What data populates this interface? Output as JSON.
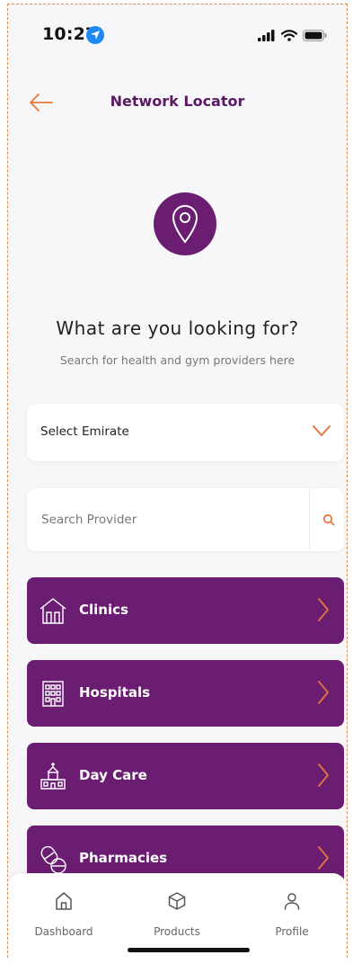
{
  "status_bar": {
    "time": "10:27"
  },
  "header": {
    "title": "Network Locator"
  },
  "hero": {
    "title": "What are you looking for?",
    "subtitle": "Search for health and gym providers here"
  },
  "select": {
    "label": "Select Emirate"
  },
  "search": {
    "placeholder": "Search Provider"
  },
  "categories": [
    {
      "label": "Clinics",
      "icon": "clinic-icon"
    },
    {
      "label": "Hospitals",
      "icon": "hospital-icon"
    },
    {
      "label": "Day Care",
      "icon": "day-care-icon"
    },
    {
      "label": "Pharmacies",
      "icon": "pharmacy-icon"
    }
  ],
  "bottom_nav": [
    {
      "label": "Dashboard",
      "icon": "home-icon"
    },
    {
      "label": "Products",
      "icon": "box-icon"
    },
    {
      "label": "Profile",
      "icon": "user-icon"
    }
  ],
  "colors": {
    "primary": "#6b1d72",
    "accent": "#e8763a",
    "background": "#f7f7f9"
  }
}
